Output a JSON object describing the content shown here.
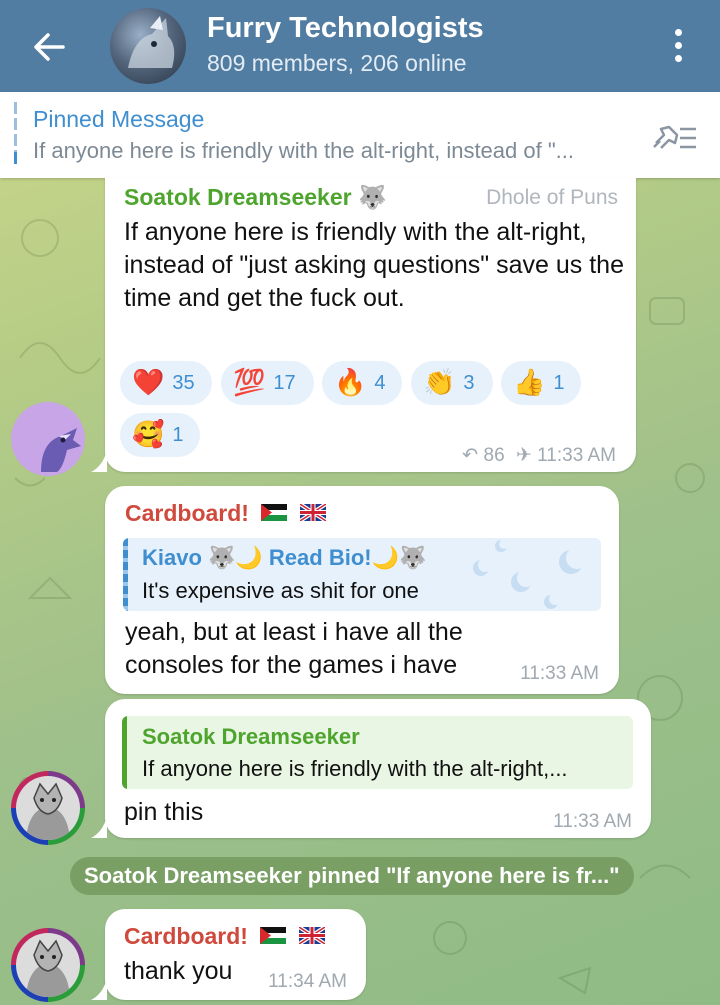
{
  "header": {
    "title": "Furry Technologists",
    "subtitle": "809 members, 206 online"
  },
  "pinned": {
    "title": "Pinned Message",
    "text": "If anyone here is friendly with the alt-right, instead of \"..."
  },
  "messages": [
    {
      "sender": "Soatok Dreamseeker",
      "sender_emoji": "🐺",
      "rank": "Dhole of Puns",
      "text": "If anyone here is friendly with the alt-right, instead of \"just asking questions\" save us the time and get the fuck out.",
      "reactions": [
        {
          "emoji": "❤️",
          "count": "35"
        },
        {
          "emoji": "💯",
          "count": "17"
        },
        {
          "emoji": "🔥",
          "count": "4"
        },
        {
          "emoji": "👏",
          "count": "3"
        },
        {
          "emoji": "👍",
          "count": "1"
        },
        {
          "emoji": "🥰",
          "count": "1"
        }
      ],
      "forwards": "86",
      "time": "11:33 AM"
    },
    {
      "sender": "Cardboard!",
      "reply": {
        "author": "Kiavo 🐺🌙 Read Bio!🌙🐺",
        "text": "It's expensive as shit for one"
      },
      "text": "yeah, but at least i have all the consoles for the games i have",
      "time": "11:33 AM"
    },
    {
      "reply": {
        "author": "Soatok Dreamseeker",
        "text": "If anyone here is friendly with the alt-right,..."
      },
      "text": "pin this",
      "time": "11:33 AM"
    },
    {
      "sender": "Cardboard!",
      "text": "thank you",
      "time": "11:34 AM"
    }
  ],
  "service": {
    "text": "Soatok Dreamseeker pinned \"If anyone here is fr...\""
  },
  "colors": {
    "header": "#517da2",
    "link": "#3e8ed0",
    "soatok": "#4ea52e",
    "cardboard": "#cf4a3c",
    "bubble": "#ffffff"
  }
}
